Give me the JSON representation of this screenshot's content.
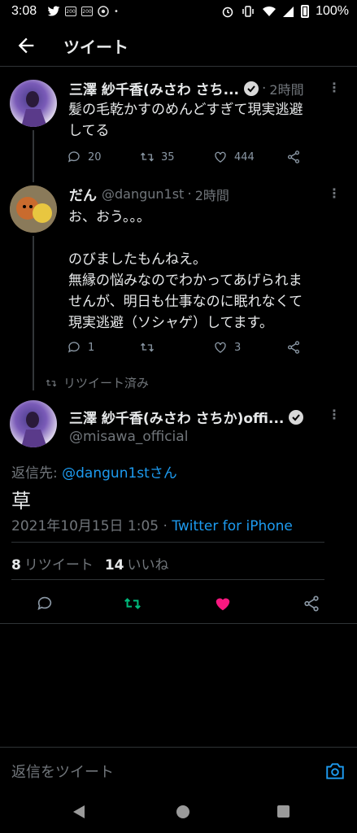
{
  "status_bar": {
    "time": "3:08",
    "battery": "100%",
    "left_icons": [
      "twitter-icon",
      "sim-icon",
      "sim-icon",
      "chrome-icon"
    ],
    "right_icons": [
      "alarm-icon",
      "vibrate-icon",
      "wifi-icon",
      "signal-icon",
      "battery-icon"
    ]
  },
  "header": {
    "title": "ツイート"
  },
  "tweets": [
    {
      "name": "三澤 紗千香(みさわ さち...",
      "time": "2時間",
      "text": "髪の毛乾かすのめんどすぎて現実逃避\nしてる",
      "replies": "20",
      "retweets": "35",
      "likes": "444"
    },
    {
      "name": "だん",
      "handle": "@dangun1st",
      "time": "2時間",
      "text": "お、おう。。。\n\nのびましたもんねえ。\n無縁の悩みなのでわかってあげられま\nせんが、明日も仕事なのに眠れなくて\n現実逃避（ソシャゲ）してます。",
      "replies": "1",
      "retweets": "",
      "likes": "3"
    }
  ],
  "retweeted_label": "リツイート済み",
  "main_tweet": {
    "name": "三澤 紗千香(みさわ さちか)offi...",
    "handle": "@misawa_official",
    "reply_prefix": "返信先: ",
    "reply_target": "@dangun1stさん",
    "text": "草",
    "timestamp": "2021年10月15日 1:05 · ",
    "source": "Twitter for iPhone",
    "retweet_count": "8",
    "retweet_label": "リツイート",
    "like_count": "14",
    "like_label": "いいね"
  },
  "colors": {
    "accent": "#1d9bf0",
    "retweet_active": "#00ba7c",
    "like_active": "#f91880",
    "muted": "#71767b"
  },
  "reply_bar": {
    "placeholder": "返信をツイート"
  }
}
